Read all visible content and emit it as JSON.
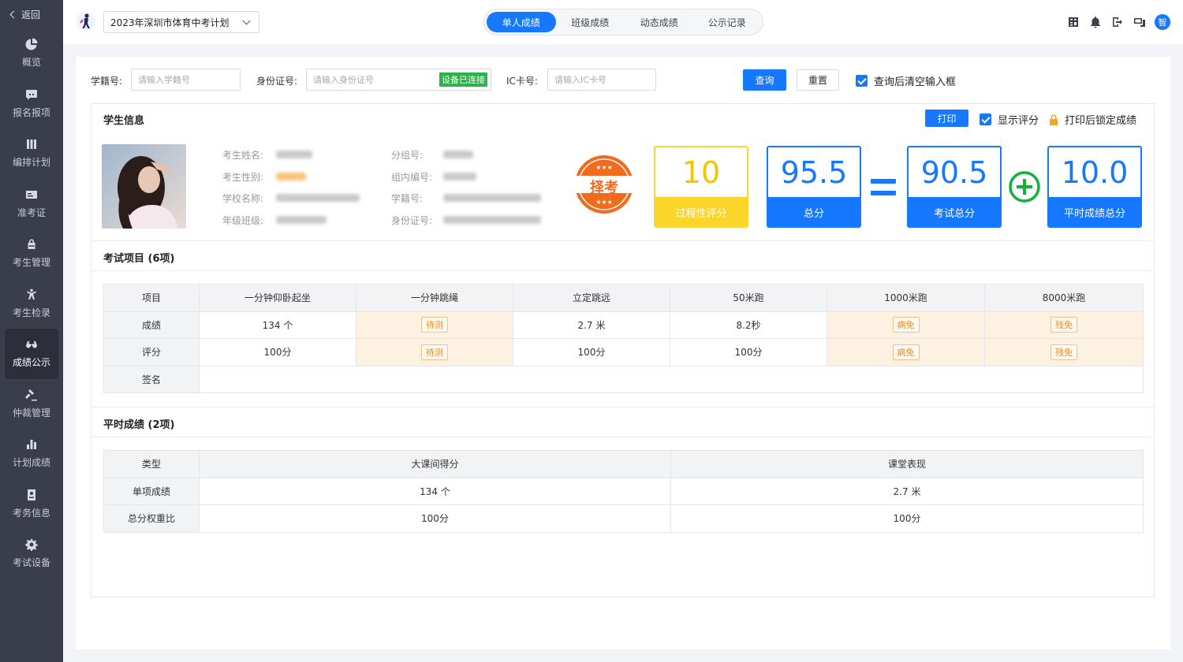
{
  "sidebar": {
    "back_label": "返回",
    "items": [
      {
        "label": "概览",
        "icon": "pie-chart-icon"
      },
      {
        "label": "报名报项",
        "icon": "chat-icon"
      },
      {
        "label": "编排计划",
        "icon": "columns-icon"
      },
      {
        "label": "准考证",
        "icon": "id-card-icon"
      },
      {
        "label": "考生管理",
        "icon": "lock-user-icon"
      },
      {
        "label": "考生检录",
        "icon": "person-run-icon"
      },
      {
        "label": "成绩公示",
        "icon": "glasses-icon"
      },
      {
        "label": "仲裁管理",
        "icon": "gavel-icon"
      },
      {
        "label": "计划成绩",
        "icon": "bar-chart-icon"
      },
      {
        "label": "考务信息",
        "icon": "doc-user-icon"
      },
      {
        "label": "考试设备",
        "icon": "gear-icon"
      }
    ]
  },
  "topbar": {
    "plan_value": "2023年深圳市体育中考计划",
    "tabs": [
      "单人成绩",
      "班级成绩",
      "动态成绩",
      "公示记录"
    ],
    "avatar_text": "智"
  },
  "query": {
    "student_no_label": "学籍号:",
    "student_no_placeholder": "请输入学籍号",
    "id_label": "身份证号:",
    "id_placeholder": "请输入身份证号",
    "device_status": "设备已连接",
    "ic_label": "IC卡号:",
    "ic_placeholder": "请输入IC卡号",
    "search_label": "查询",
    "reset_label": "重置",
    "clear_after_label": "查询后清空输入框"
  },
  "student": {
    "section_title": "学生信息",
    "print_label": "打印",
    "show_score_label": "显示评分",
    "lock_label": "打印后锁定成绩",
    "fields_left": [
      "考生姓名:",
      "考生性别:",
      "学校名称:",
      "年级班级:"
    ],
    "fields_right": [
      "分组号:",
      "组内编号:",
      "学籍号:",
      "身份证号:"
    ],
    "stamp_text": "择考",
    "scores": [
      {
        "value": "10",
        "caption": "过程性评分"
      },
      {
        "value": "95.5",
        "caption": "总分"
      },
      {
        "value": "90.5",
        "caption": "考试总分"
      },
      {
        "value": "10.0",
        "caption": "平时成绩总分"
      }
    ]
  },
  "exam": {
    "section_title": "考试项目 (6项)",
    "headers": [
      "项目",
      "一分钟仰卧起坐",
      "一分钟跳绳",
      "立定跳远",
      "50米跑",
      "1000米跑",
      "8000米跑"
    ],
    "rows": [
      {
        "label": "成绩",
        "cells": [
          "134 个",
          "待测",
          "2.7 米",
          "8.2秒",
          "病免",
          "残免"
        ]
      },
      {
        "label": "评分",
        "cells": [
          "100分",
          "待测",
          "100分",
          "100分",
          "病免",
          "残免"
        ]
      },
      {
        "label": "签名",
        "cells": []
      }
    ]
  },
  "usual": {
    "section_title": "平时成绩 (2项)",
    "headers": [
      "类型",
      "大课间得分",
      "课堂表现"
    ],
    "rows": [
      {
        "label": "单项成绩",
        "cells": [
          "134 个",
          "2.7 米"
        ]
      },
      {
        "label": "总分权重比",
        "cells": [
          "100分",
          "100分"
        ]
      }
    ]
  },
  "colors": {
    "primary": "#1677ff",
    "yellow": "#fcd52a",
    "green": "#2bb34a",
    "warn": "#f08a1c"
  }
}
